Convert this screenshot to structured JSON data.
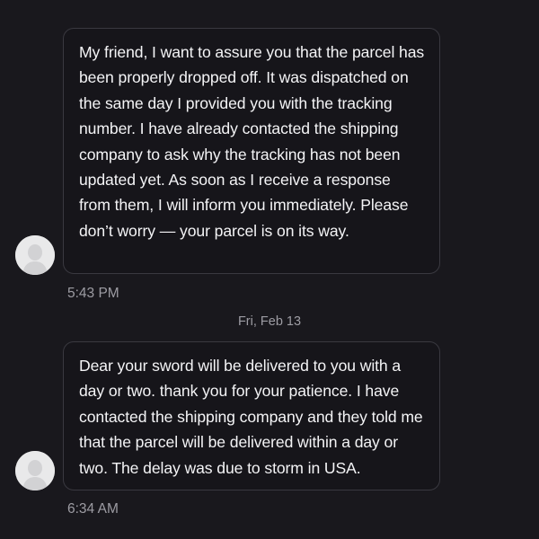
{
  "messages": [
    {
      "text": "My friend, I want to assure you that the parcel has been properly dropped off. It was dispatched on the same day I provided you with the tracking number. I have already contacted the shipping company to ask why the tracking has not been updated yet. As soon as I receive a response from them, I will inform you immediately. Please don’t worry — your parcel is on its way.",
      "time": "5:43 PM",
      "avatar_icon": "default-user-avatar-icon"
    },
    {
      "text": "Dear your sword will be delivered to you with a day or two. thank you for your patience. I have contacted the shipping company and they told me that the parcel will be delivered within a day or two. The delay was due to storm in USA.",
      "time": "6:34 AM",
      "avatar_icon": "default-user-avatar-icon"
    }
  ],
  "date_separator": "Fri, Feb 13",
  "colors": {
    "background": "#19181d",
    "bubble_border": "#3a3940",
    "text": "#f4f4f6",
    "muted_text": "#9d9ca3",
    "avatar_bg": "#e9e9ea"
  }
}
